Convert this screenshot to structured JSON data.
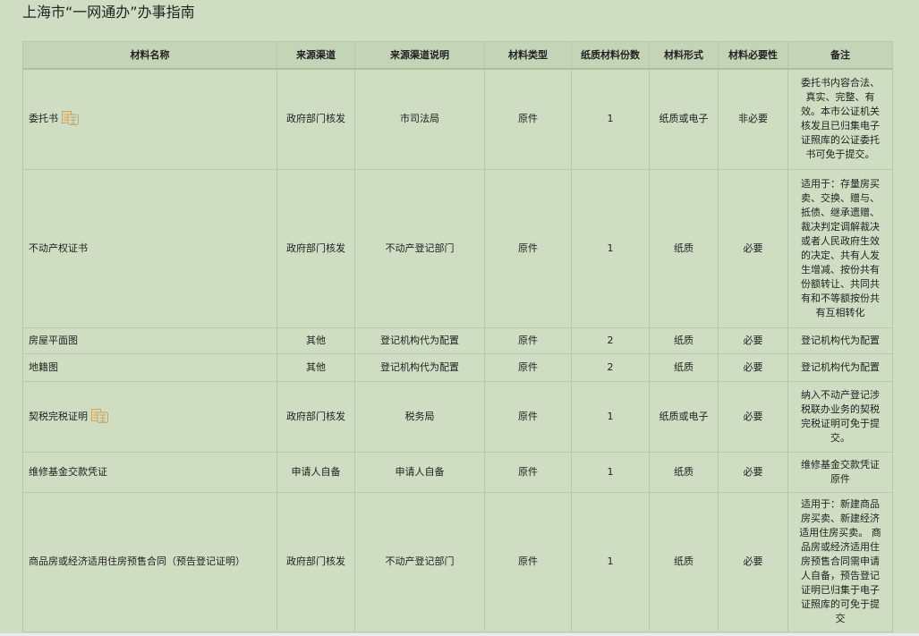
{
  "page": {
    "title": "上海市“一网通办”办事指南"
  },
  "table": {
    "headers": {
      "name": "材料名称",
      "source": "来源渠道",
      "source_desc": "来源渠道说明",
      "type": "材料类型",
      "copies": "纸质材料份数",
      "form": "材料形式",
      "necessity": "材料必要性",
      "remark": "备注"
    },
    "rows": [
      {
        "name": "委托书",
        "has_exempt_icon": true,
        "source": "政府部门核发",
        "source_desc": "市司法局",
        "type": "原件",
        "copies": "1",
        "form": "纸质或电子",
        "necessity": "非必要",
        "remark": "委托书内容合法、真实、完整、有效。本市公证机关核发且已归集电子证照库的公证委托书可免于提交。"
      },
      {
        "name": "不动产权证书",
        "has_exempt_icon": false,
        "source": "政府部门核发",
        "source_desc": "不动产登记部门",
        "type": "原件",
        "copies": "1",
        "form": "纸质",
        "necessity": "必要",
        "remark": "适用于：存量房买卖、交换、赠与、抵债、继承遗赠、裁决判定调解裁决或者人民政府生效的决定、共有人发生增减、按份共有份额转让、共同共有和不等额按份共有互相转化"
      },
      {
        "name": "房屋平面图",
        "has_exempt_icon": false,
        "source": "其他",
        "source_desc": "登记机构代为配置",
        "type": "原件",
        "copies": "2",
        "form": "纸质",
        "necessity": "必要",
        "remark": "登记机构代为配置"
      },
      {
        "name": "地籍图",
        "has_exempt_icon": false,
        "source": "其他",
        "source_desc": "登记机构代为配置",
        "type": "原件",
        "copies": "2",
        "form": "纸质",
        "necessity": "必要",
        "remark": "登记机构代为配置"
      },
      {
        "name": "契税完税证明",
        "has_exempt_icon": true,
        "source": "政府部门核发",
        "source_desc": "税务局",
        "type": "原件",
        "copies": "1",
        "form": "纸质或电子",
        "necessity": "必要",
        "remark": "纳入不动产登记涉税联办业务的契税完税证明可免于提交。"
      },
      {
        "name": "维修基金交款凭证",
        "has_exempt_icon": false,
        "source": "申请人自备",
        "source_desc": "申请人自备",
        "type": "原件",
        "copies": "1",
        "form": "纸质",
        "necessity": "必要",
        "remark": "维修基金交款凭证原件"
      },
      {
        "name": "商品房或经济适用住房预售合同（预告登记证明）",
        "has_exempt_icon": false,
        "source": "政府部门核发",
        "source_desc": "不动产登记部门",
        "type": "原件",
        "copies": "1",
        "form": "纸质",
        "necessity": "必要",
        "remark": "适用于：新建商品房买卖、新建经济适用住房买卖。 商品房或经济适用住房预售合同需申请人自备，预告登记证明已归集于电子证照库的可免于提交"
      }
    ]
  },
  "icons": {
    "exempt_icon": "mian-exempt-stamp-icon"
  },
  "colors": {
    "page_background": "#cfdec2",
    "header_background": "#c4d4b7",
    "border": "#b8c9ab",
    "exempt_icon": "#c2a86a"
  }
}
